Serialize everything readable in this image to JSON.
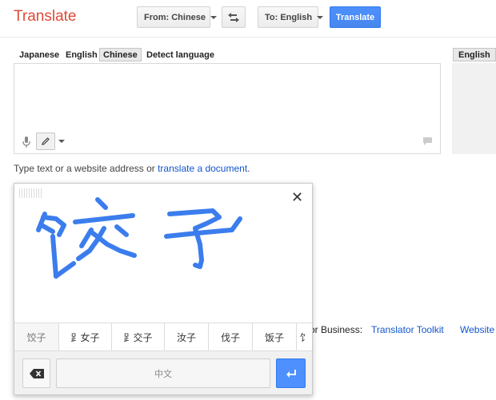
{
  "header": {
    "title": "Translate",
    "from_label": "From: Chinese",
    "to_label": "To: English",
    "translate_label": "Translate",
    "swap_icon": "swap-arrows-icon"
  },
  "source_tabs": [
    "Japanese",
    "English",
    "Chinese",
    "Detect language"
  ],
  "selected_source_tab": "Chinese",
  "target_tab": "English",
  "source": {
    "text": "",
    "icons": [
      "microphone-icon",
      "pencil-icon",
      "chevron-down-icon",
      "feedback-icon"
    ]
  },
  "hint": {
    "prefix": "Type text or a website address or ",
    "link": "translate a document",
    "suffix": "."
  },
  "footer": {
    "business_label": "or Business:",
    "toolkit_link": "Translator Toolkit",
    "website_link": "Website"
  },
  "handwriting": {
    "close_symbol": "✕",
    "candidates": [
      "饺子",
      "⻊女子",
      "⻊交子",
      "汝子",
      "伐子",
      "饭子",
      "饣"
    ],
    "space_label": "中文",
    "ink_color": "#3b7ded"
  }
}
